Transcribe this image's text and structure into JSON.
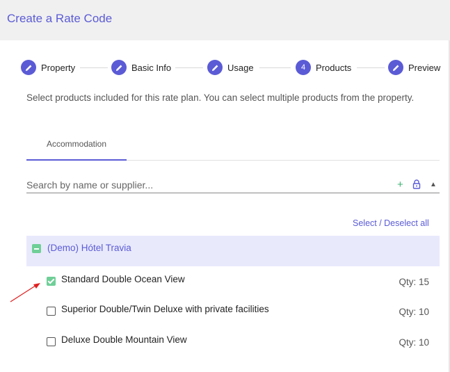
{
  "header": {
    "title": "Create a Rate Code"
  },
  "stepper": {
    "steps": [
      {
        "label": "Property",
        "icon": "pencil-icon",
        "number": ""
      },
      {
        "label": "Basic Info",
        "icon": "pencil-icon",
        "number": ""
      },
      {
        "label": "Usage",
        "icon": "pencil-icon",
        "number": ""
      },
      {
        "label": "Products",
        "icon": "",
        "number": "4"
      },
      {
        "label": "Preview",
        "icon": "pencil-icon",
        "number": ""
      }
    ],
    "active_step": 4
  },
  "description": "Select products included for this rate plan. You can select multiple products from the property.",
  "tabs": [
    {
      "label": "Accommodation",
      "active": true
    }
  ],
  "search": {
    "placeholder": "Search by name or supplier...",
    "value": ""
  },
  "toolbar_icons": [
    "plus-icon",
    "lock-icon",
    "caret-up-icon"
  ],
  "select_all_label": "Select / Deselect all",
  "group": {
    "label": "(Demo) Hótel Travia",
    "state": "indeterminate"
  },
  "products": [
    {
      "name": "Standard Double Ocean View",
      "qty": "Qty: 15",
      "checked": true
    },
    {
      "name": "Superior Double/Twin Deluxe with private facilities",
      "qty": "Qty: 10",
      "checked": false
    },
    {
      "name": "Deluxe Double Mountain View",
      "qty": "Qty: 10",
      "checked": false
    }
  ],
  "colors": {
    "accent": "#5b5bd6",
    "check_green": "#6fcf97",
    "group_bg": "#e8e9fb",
    "header_bg": "#f0f0f0",
    "annotation_arrow": "#e02020"
  }
}
